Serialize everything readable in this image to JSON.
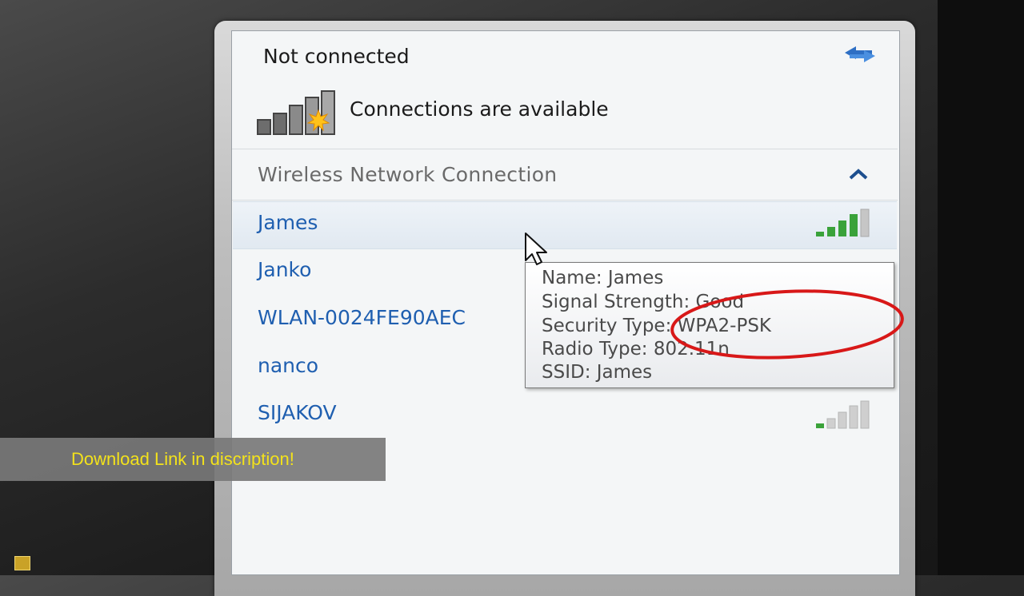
{
  "status": {
    "title": "Not connected",
    "available": "Connections are available"
  },
  "section": {
    "title": "Wireless Network Connection"
  },
  "networks": [
    {
      "name": "James",
      "signal_bars": 4,
      "of": 5
    },
    {
      "name": "Janko"
    },
    {
      "name": "WLAN-0024FE90AEC"
    },
    {
      "name": "nanco"
    },
    {
      "name": "SIJAKOV",
      "signal_bars": 1,
      "of": 5
    }
  ],
  "tooltip": {
    "name": "Name: James",
    "signal": "Signal Strength: Good",
    "security": "Security Type: WPA2-PSK",
    "radio": "Radio Type: 802.11n",
    "ssid": "SSID: James"
  },
  "banner": {
    "text": "Download Link in discription!"
  },
  "colors": {
    "link_blue": "#1f5fb0",
    "signal_green": "#3aa23a",
    "highlight_red": "#d81818",
    "banner_yellow": "#f3e21b"
  },
  "icons": {
    "refresh": "refresh-arrows-icon",
    "signal_big": "wireless-signal-available-icon",
    "collapse": "chevron-up-icon",
    "cursor": "mouse-pointer-icon"
  }
}
